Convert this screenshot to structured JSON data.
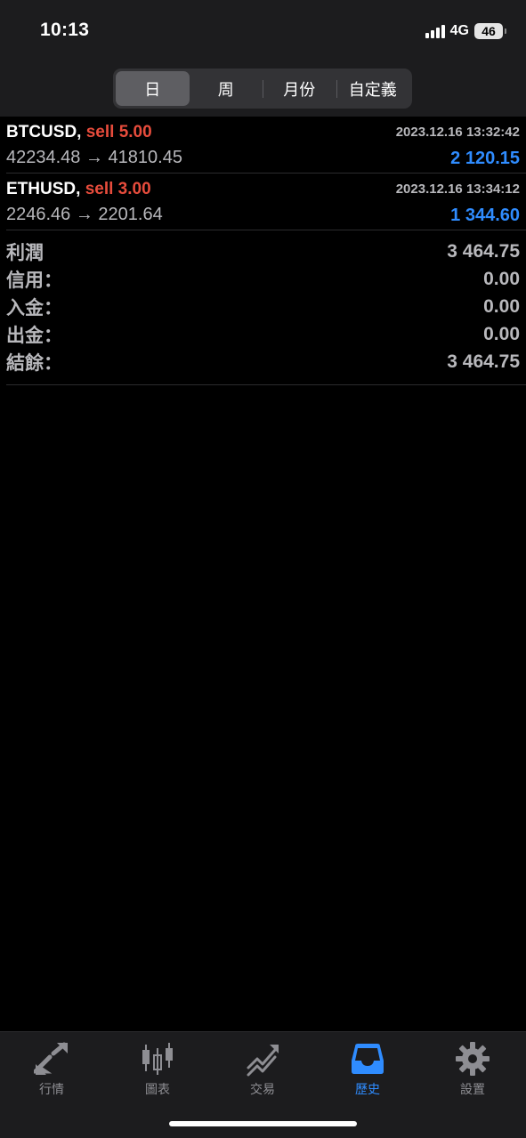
{
  "status": {
    "time": "10:13",
    "network": "4G",
    "battery": "46"
  },
  "segments": [
    {
      "label": "日",
      "active": true
    },
    {
      "label": "周",
      "active": false
    },
    {
      "label": "月份",
      "active": false
    },
    {
      "label": "自定義",
      "active": false
    }
  ],
  "trades": [
    {
      "symbol": "BTCUSD,",
      "side": "sell 5.00",
      "datetime": "2023.12.16 13:32:42",
      "prices": "42234.48 → 41810.45",
      "profit": "2 120.15"
    },
    {
      "symbol": "ETHUSD,",
      "side": "sell 3.00",
      "datetime": "2023.12.16 13:34:12",
      "prices": "2246.46 → 2201.64",
      "profit": "1 344.60"
    }
  ],
  "summary": [
    {
      "label": "利潤",
      "value": "3 464.75"
    },
    {
      "label": "信用：",
      "value": "0.00"
    },
    {
      "label": "入金：",
      "value": "0.00"
    },
    {
      "label": "出金：",
      "value": "0.00"
    },
    {
      "label": "結餘：",
      "value": "3 464.75"
    }
  ],
  "tabbar": [
    {
      "label": "行情",
      "icon": "quotes-icon"
    },
    {
      "label": "圖表",
      "icon": "chart-candles-icon"
    },
    {
      "label": "交易",
      "icon": "trade-icon"
    },
    {
      "label": "歷史",
      "icon": "history-inbox-icon",
      "active": true
    },
    {
      "label": "設置",
      "icon": "settings-gear-icon"
    }
  ],
  "colors": {
    "sell": "#e74c3c",
    "profit": "#2f8cff",
    "active_tab": "#2f8cff",
    "inactive_tab": "#8e8e93"
  }
}
